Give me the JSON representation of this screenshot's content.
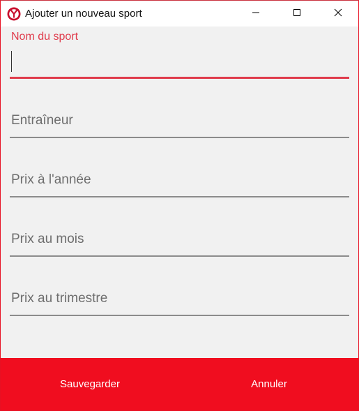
{
  "window": {
    "title": "Ajouter un nouveau sport",
    "icon": "app-logo-icon",
    "controls": [
      "minimize-icon",
      "maximize-icon",
      "close-icon"
    ]
  },
  "form": {
    "sport_name": {
      "label": "Nom du sport",
      "value": ""
    },
    "coach": {
      "placeholder": "Entraîneur",
      "value": ""
    },
    "price_year": {
      "placeholder": "Prix à l'année",
      "value": ""
    },
    "price_month": {
      "placeholder": "Prix au mois",
      "value": ""
    },
    "price_quarter": {
      "placeholder": "Prix au trimestre",
      "value": ""
    }
  },
  "footer": {
    "save_label": "Sauvegarder",
    "cancel_label": "Annuler"
  },
  "colors": {
    "accent": "#e03c4c",
    "footer_bg": "#f00d1f",
    "form_bg": "#f1f1f1"
  }
}
